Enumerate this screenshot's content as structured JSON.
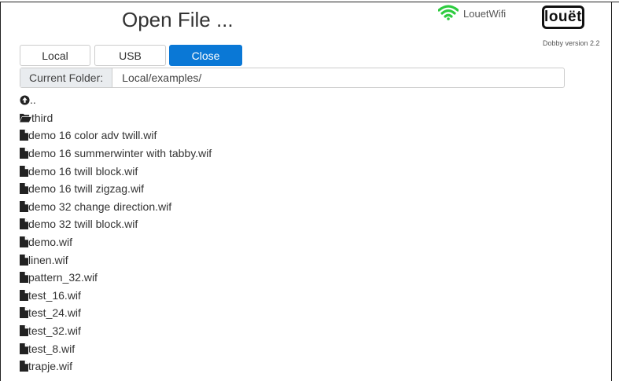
{
  "header": {
    "title": "Open File ...",
    "wifi_label": "LouetWifi",
    "logo_text": "louët",
    "version": "Dobby version 2.2"
  },
  "buttons": {
    "local": "Local",
    "usb": "USB",
    "close": "Close"
  },
  "folder": {
    "label": "Current Folder:",
    "path": "Local/examples/"
  },
  "entries": [
    {
      "type": "up",
      "name": ".."
    },
    {
      "type": "folder",
      "name": "third"
    },
    {
      "type": "file",
      "name": "demo 16 color adv twill.wif"
    },
    {
      "type": "file",
      "name": "demo 16 summerwinter with tabby.wif"
    },
    {
      "type": "file",
      "name": "demo 16 twill block.wif"
    },
    {
      "type": "file",
      "name": "demo 16 twill zigzag.wif"
    },
    {
      "type": "file",
      "name": "demo 32 change direction.wif"
    },
    {
      "type": "file",
      "name": "demo 32 twill block.wif"
    },
    {
      "type": "file",
      "name": "demo.wif"
    },
    {
      "type": "file",
      "name": "linen.wif"
    },
    {
      "type": "file",
      "name": "pattern_32.wif"
    },
    {
      "type": "file",
      "name": "test_16.wif"
    },
    {
      "type": "file",
      "name": "test_24.wif"
    },
    {
      "type": "file",
      "name": "test_32.wif"
    },
    {
      "type": "file",
      "name": "test_8.wif"
    },
    {
      "type": "file",
      "name": "trapje.wif"
    }
  ],
  "colors": {
    "accent": "#0a78d6",
    "wifi": "#2ecc40"
  }
}
